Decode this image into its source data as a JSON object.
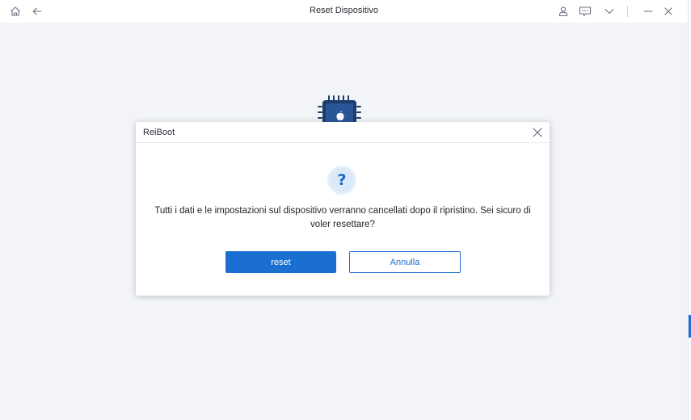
{
  "window": {
    "title": "Reset Dispositivo",
    "icons": {
      "home": "home-icon",
      "back": "back-arrow-icon",
      "account": "user-icon",
      "feedback": "feedback-icon",
      "menu": "chevron-down-icon",
      "minimize": "minimize-icon",
      "close": "close-icon"
    }
  },
  "background": {
    "graphic": "chip-icon"
  },
  "dialog": {
    "title": "ReiBoot",
    "icon": "question-icon",
    "question_mark": "?",
    "message": "Tutti i dati e le impostazioni sul dispositivo verranno cancellati dopo il ripristino. Sei sicuro di voler resettare?",
    "confirm_label": "reset",
    "cancel_label": "Annulla"
  },
  "colors": {
    "accent": "#1a6fd1",
    "background": "#f2f4f8",
    "text": "#1f2329"
  }
}
